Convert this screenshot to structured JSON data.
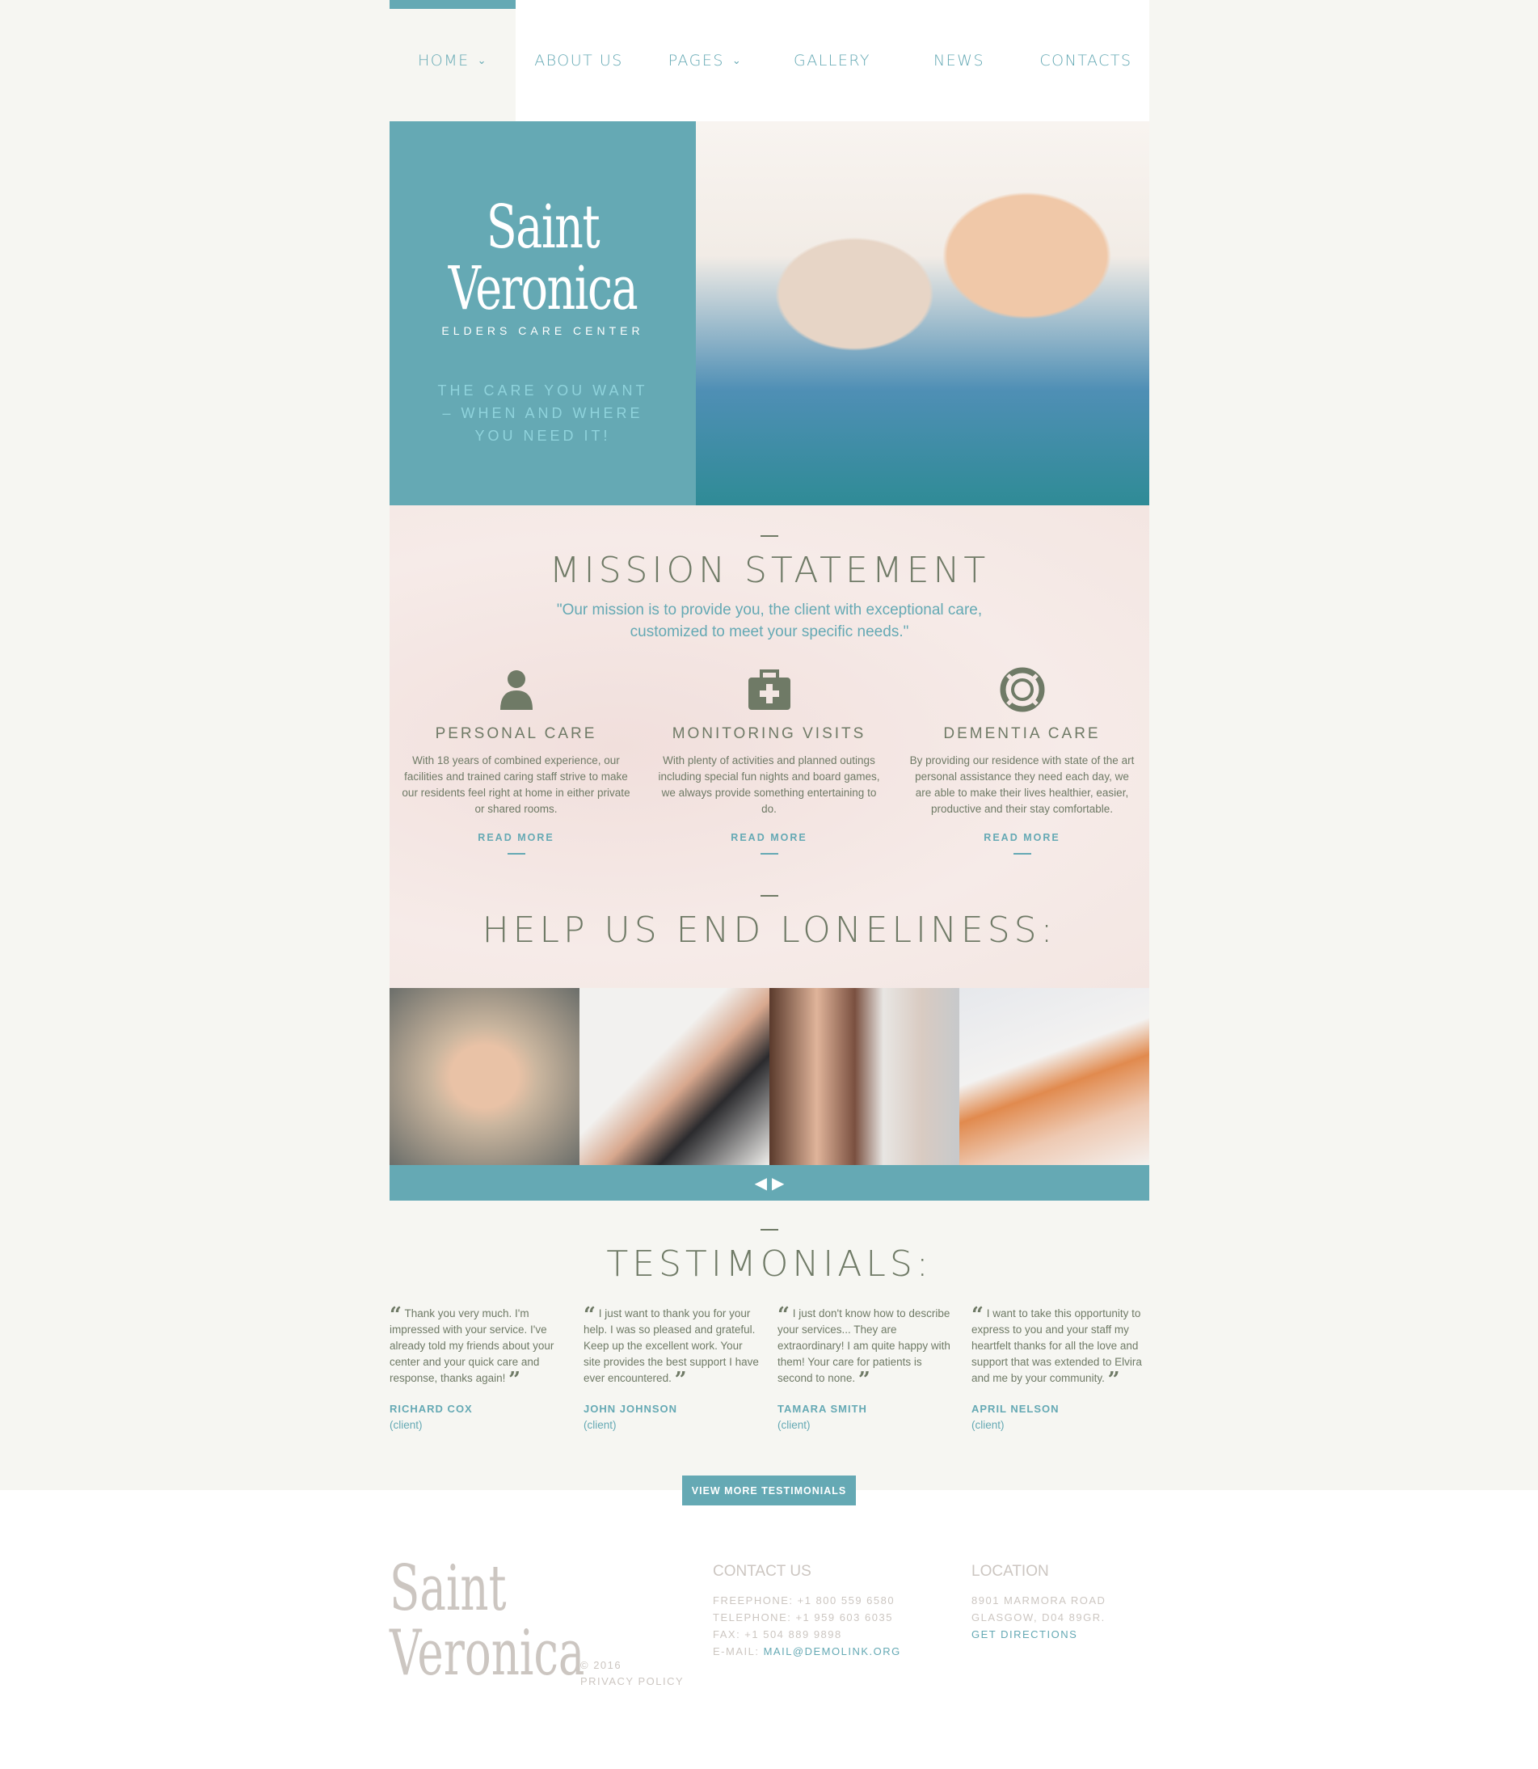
{
  "nav": {
    "items": [
      {
        "label": "HOME",
        "dropdown": true
      },
      {
        "label": "ABOUT US"
      },
      {
        "label": "PAGES",
        "dropdown": true
      },
      {
        "label": "GALLERY"
      },
      {
        "label": "NEWS"
      },
      {
        "label": "CONTACTS"
      }
    ]
  },
  "hero": {
    "logo_line1": "Saint",
    "logo_line2": "Veronica",
    "tagline": "ELDERS CARE CENTER",
    "slogan": "THE CARE YOU WANT – WHEN AND WHERE YOU NEED IT!"
  },
  "mission": {
    "title": "MISSION STATEMENT",
    "quote": "\"Our mission is to provide you, the client with exceptional care, customized to meet your specific needs.\"",
    "features": [
      {
        "icon": "person-icon",
        "title": "PERSONAL CARE",
        "text": "With 18 years of combined experience, our facilities and trained caring staff strive to make our residents feel right at home in either private or shared rooms.",
        "link": "READ MORE"
      },
      {
        "icon": "first-aid-kit-icon",
        "title": "MONITORING VISITS",
        "text": "With plenty of activities and planned outings including special fun nights and board games, we always provide something entertaining to do.",
        "link": "READ MORE"
      },
      {
        "icon": "life-ring-icon",
        "title": "DEMENTIA CARE",
        "text": "By providing our residence with state of the art personal assistance they need each day, we are able to make their lives healthier, easier, productive and their stay comfortable.",
        "link": "READ MORE"
      }
    ]
  },
  "loneliness": {
    "title": "HELP US END LONELINESS:"
  },
  "slider": {
    "prev": "◀",
    "next": "▶"
  },
  "testimonials": {
    "title": "TESTIMONIALS:",
    "items": [
      {
        "text": "Thank you very much. I'm impressed with your service. I've already told my friends about your center and your quick care and response, thanks again!",
        "name": "RICHARD COX",
        "role": "(client)"
      },
      {
        "text": "I just want to thank you for your help. I was so pleased and grateful. Keep up the excellent work. Your site provides the best support I have ever encountered.",
        "name": "JOHN JOHNSON",
        "role": "(client)"
      },
      {
        "text": "I just don't know how to describe your services... They are extraordinary! I am quite happy with them! Your care for patients is second to none.",
        "name": "TAMARA SMITH",
        "role": "(client)"
      },
      {
        "text": "I want to take this opportunity to express to you and your staff my heartfelt thanks for all the love and support that was extended to Elvira and me by your community.",
        "name": "APRIL NELSON",
        "role": "(client)"
      }
    ],
    "button": "VIEW MORE TESTIMONIALS"
  },
  "footer": {
    "logo_line1": "Saint",
    "logo_line2": "Veronica",
    "copyright": "© 2016",
    "privacy": "PRIVACY POLICY",
    "contact": {
      "title": "CONTACT US",
      "freephone": "FREEPHONE: +1 800 559 6580",
      "telephone": "TELEPHONE: +1 959 603 6035",
      "fax": "FAX: +1 504 889 9898",
      "email_label": "E-MAIL: ",
      "email": "MAIL@DEMOLINK.ORG"
    },
    "location": {
      "title": "LOCATION",
      "line1": "8901 MARMORA ROAD",
      "line2": "GLASGOW, D04 89GR.",
      "directions": "GET DIRECTIONS"
    }
  },
  "colors": {
    "accent": "#65a9b4",
    "text": "#6f7a66",
    "footer_text": "#ccc6c1"
  }
}
